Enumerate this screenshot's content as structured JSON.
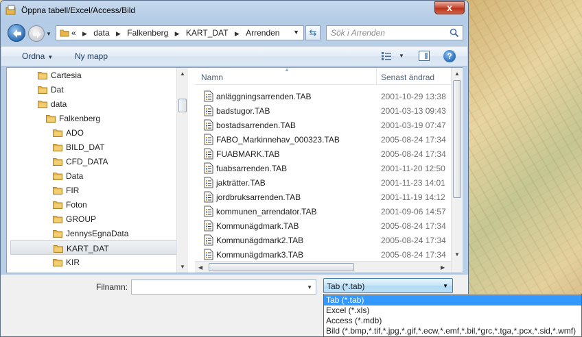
{
  "window": {
    "title": "Öppna tabell/Excel/Access/Bild",
    "close_label": "x"
  },
  "address": {
    "overflow": "«",
    "crumbs": [
      "data",
      "Falkenberg",
      "KART_DAT",
      "Arrenden"
    ]
  },
  "search": {
    "placeholder": "Sök i Arrenden"
  },
  "toolbar": {
    "organize_label": "Ordna",
    "new_folder_label": "Ny mapp",
    "help_label": "?"
  },
  "tree": {
    "items": [
      {
        "label": "Cartesia",
        "level": 1
      },
      {
        "label": "Dat",
        "level": 1
      },
      {
        "label": "data",
        "level": 1
      },
      {
        "label": "Falkenberg",
        "level": 2
      },
      {
        "label": "ADO",
        "level": 3
      },
      {
        "label": "BILD_DAT",
        "level": 3
      },
      {
        "label": "CFD_DATA",
        "level": 3
      },
      {
        "label": "Data",
        "level": 3
      },
      {
        "label": "FIR",
        "level": 3
      },
      {
        "label": "Foton",
        "level": 3
      },
      {
        "label": "GROUP",
        "level": 3
      },
      {
        "label": "JennysEgnaData",
        "level": 3
      },
      {
        "label": "KART_DAT",
        "level": 3,
        "selected": true
      },
      {
        "label": "KIR",
        "level": 3
      }
    ]
  },
  "files": {
    "columns": {
      "name": "Namn",
      "date": "Senast ändrad"
    },
    "rows": [
      {
        "name": "anläggningsarrenden.TAB",
        "date": "2001-10-29 13:38"
      },
      {
        "name": "badstugor.TAB",
        "date": "2001-03-13 09:43"
      },
      {
        "name": "bostadsarrenden.TAB",
        "date": "2001-03-19 07:47"
      },
      {
        "name": "FABO_Markinnehav_000323.TAB",
        "date": "2005-08-24 17:34"
      },
      {
        "name": "FUABMARK.TAB",
        "date": "2005-08-24 17:34"
      },
      {
        "name": "fuabsarrenden.TAB",
        "date": "2001-11-20 12:50"
      },
      {
        "name": "jakträtter.TAB",
        "date": "2001-11-23 14:01"
      },
      {
        "name": "jordbruksarrenden.TAB",
        "date": "2001-11-19 14:12"
      },
      {
        "name": "kommunen_arrendator.TAB",
        "date": "2001-09-06 14:57"
      },
      {
        "name": "Kommunägdmark.TAB",
        "date": "2005-08-24 17:34"
      },
      {
        "name": "Kommunägdmark2.TAB",
        "date": "2005-08-24 17:34"
      },
      {
        "name": "Kommunägdmark3.TAB",
        "date": "2005-08-24 17:34"
      }
    ]
  },
  "bottom": {
    "filename_label": "Filnamn:",
    "filename_value": "",
    "filetype_selected": "Tab (*.tab)",
    "filetype_options": [
      {
        "label": "Tab (*.tab)",
        "selected": true
      },
      {
        "label": "Excel (*.xls)"
      },
      {
        "label": "Access (*.mdb)"
      },
      {
        "label": "Bild (*.bmp,*.tif,*.jpg,*.gif,*.ecw,*.emf,*.bil,*grc,*.tga,*.pcx,*.sid,*.wmf)"
      }
    ]
  },
  "colors": {
    "selection": "#3399ff",
    "folder": "#e8b64a",
    "link_blue": "#1e395b"
  },
  "icons": {
    "title": "dialog-icon",
    "back": "back-arrow-icon",
    "forward": "forward-arrow-icon",
    "refresh": "refresh-icon",
    "search": "search-icon",
    "views": "view-details-icon",
    "preview": "preview-pane-icon",
    "help": "help-icon",
    "folder": "folder-icon",
    "file": "tab-file-icon"
  }
}
